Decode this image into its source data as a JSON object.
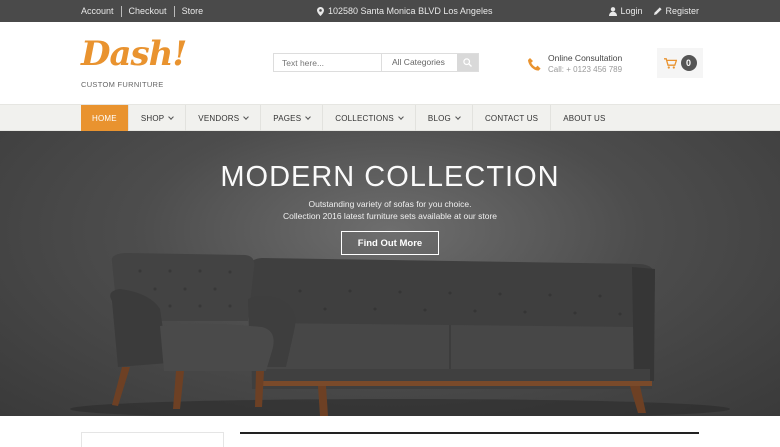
{
  "topbar": {
    "links": [
      "Account",
      "Checkout",
      "Store"
    ],
    "address": "102580 Santa Monica BLVD Los Angeles",
    "login": "Login",
    "register": "Register"
  },
  "header": {
    "logo_word": "Dash!",
    "logo_sub": "CUSTOM FURNITURE",
    "search_placeholder": "Text here...",
    "category": "All Categories",
    "consult_title": "Online Consultation",
    "consult_phone": "Call: + 0123 456 789",
    "cart_count": "0"
  },
  "nav": {
    "items": [
      "HOME",
      "SHOP",
      "VENDORS",
      "PAGES",
      "COLLECTIONS",
      "BLOG",
      "CONTACT US",
      "ABOUT US"
    ]
  },
  "hero": {
    "title": "MODERN COLLECTION",
    "line1": "Outstanding variety of sofas for you choice.",
    "line2": "Collection 2016 latest furniture sets available at our store",
    "button": "Find Out More"
  },
  "colors": {
    "accent": "#e9932f",
    "topbar": "#4a4a4a",
    "nav_bg": "#f1f1ee"
  }
}
